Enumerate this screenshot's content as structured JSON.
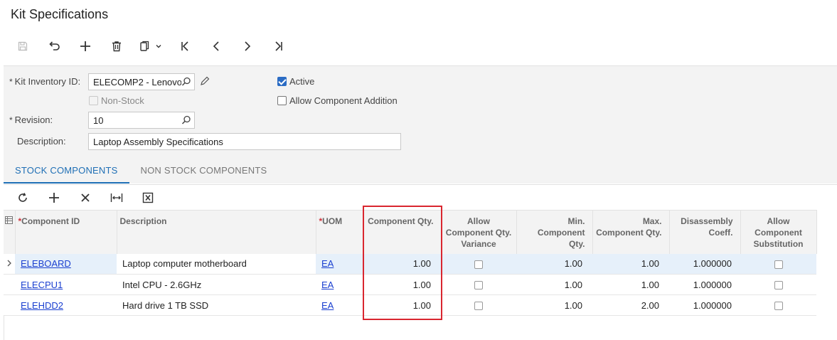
{
  "page": {
    "title": "Kit Specifications"
  },
  "toolbar": {
    "icons": [
      "save-icon",
      "undo-icon",
      "add-icon",
      "delete-icon",
      "copy-paste-icon",
      "first-icon",
      "previous-icon",
      "next-icon",
      "last-icon"
    ]
  },
  "form": {
    "kit_inventory_id": {
      "label": "Kit Inventory ID:",
      "value": "ELECOMP2 - Lenovo"
    },
    "non_stock": {
      "label": "Non-Stock",
      "checked": false,
      "disabled": true
    },
    "revision": {
      "label": "Revision:",
      "value": "10"
    },
    "description": {
      "label": "Description:",
      "value": "Laptop Assembly Specifications"
    },
    "active": {
      "label": "Active",
      "checked": true
    },
    "allow_component_addition": {
      "label": "Allow Component Addition",
      "checked": false
    }
  },
  "tabs": [
    {
      "label": "STOCK COMPONENTS",
      "active": true
    },
    {
      "label": "NON STOCK COMPONENTS",
      "active": false
    }
  ],
  "grid": {
    "toolbar_icons": [
      "refresh-icon",
      "add-row-icon",
      "delete-row-icon",
      "fit-columns-icon",
      "export-excel-icon"
    ],
    "columns": [
      {
        "label": "Component ID",
        "required": true
      },
      {
        "label": "Description",
        "required": false
      },
      {
        "label": "UOM",
        "required": true
      },
      {
        "label": "Component Qty.",
        "required": false
      },
      {
        "label": "Allow Component Qty. Variance",
        "required": false
      },
      {
        "label": "Min. Component Qty.",
        "required": false
      },
      {
        "label": "Max. Component Qty.",
        "required": false
      },
      {
        "label": "Disassembly Coeff.",
        "required": false
      },
      {
        "label": "Allow Component Substitution",
        "required": false
      }
    ],
    "rows": [
      {
        "component_id": "ELEBOARD",
        "description": "Laptop computer motherboard",
        "uom": "EA",
        "qty": "1.00",
        "allow_variance": false,
        "min_qty": "1.00",
        "max_qty": "1.00",
        "disassembly_coeff": "1.000000",
        "allow_substitution": false
      },
      {
        "component_id": "ELECPU1",
        "description": "Intel CPU - 2.6GHz",
        "uom": "EA",
        "qty": "1.00",
        "allow_variance": false,
        "min_qty": "1.00",
        "max_qty": "1.00",
        "disassembly_coeff": "1.000000",
        "allow_substitution": false
      },
      {
        "component_id": "ELEHDD2",
        "description": "Hard drive 1 TB SSD",
        "uom": "EA",
        "qty": "1.00",
        "allow_variance": false,
        "min_qty": "1.00",
        "max_qty": "2.00",
        "disassembly_coeff": "1.000000",
        "allow_substitution": false
      }
    ]
  },
  "colors": {
    "accent": "#1f6fb5",
    "highlight_border": "#d9262f",
    "link": "#1a3fd0",
    "selected_row": "#e6f0fa"
  }
}
